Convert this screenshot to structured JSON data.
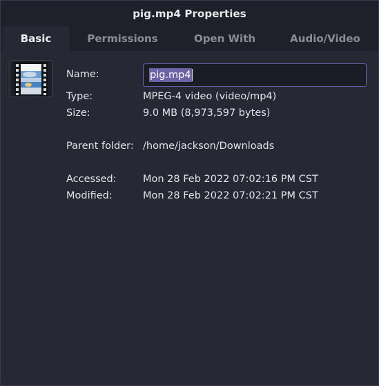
{
  "window": {
    "title": "pig.mp4 Properties"
  },
  "tabs": [
    {
      "label": "Basic",
      "active": true
    },
    {
      "label": "Permissions",
      "active": false
    },
    {
      "label": "Open With",
      "active": false
    },
    {
      "label": "Audio/Video",
      "active": false
    }
  ],
  "file": {
    "icon": "video-file-icon"
  },
  "fields": {
    "name": {
      "label": "Name:",
      "value": "pig.mp4"
    },
    "type": {
      "label": "Type:",
      "value": "MPEG-4 video (video/mp4)"
    },
    "size": {
      "label": "Size:",
      "value": "9.0 MB (8,973,597 bytes)"
    },
    "parent": {
      "label": "Parent folder:",
      "value": "/home/jackson/Downloads"
    },
    "accessed": {
      "label": "Accessed:",
      "value": "Mon 28 Feb 2022 07:02:16 PM CST"
    },
    "modified": {
      "label": "Modified:",
      "value": "Mon 28 Feb 2022 07:02:21 PM CST"
    }
  },
  "colors": {
    "background": "#262833",
    "titlebar": "#1f212a",
    "accent": "#6f63a8",
    "text": "#e3e4ea",
    "inactive_tab": "#8b8d96"
  }
}
